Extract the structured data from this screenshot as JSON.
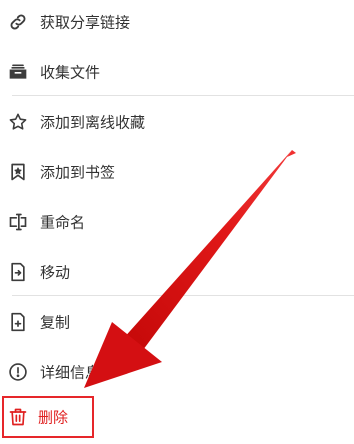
{
  "menu": {
    "items": [
      {
        "label": "获取分享链接",
        "icon": "link-icon"
      },
      {
        "label": "收集文件",
        "icon": "inbox-icon"
      },
      {
        "label": "添加到离线收藏",
        "icon": "star-icon"
      },
      {
        "label": "添加到书签",
        "icon": "bookmark-icon"
      },
      {
        "label": "重命名",
        "icon": "rename-icon"
      },
      {
        "label": "移动",
        "icon": "move-file-icon"
      },
      {
        "label": "复制",
        "icon": "copy-file-icon"
      },
      {
        "label": "详细信息",
        "icon": "info-icon"
      },
      {
        "label": "删除",
        "icon": "trash-icon"
      }
    ]
  },
  "colors": {
    "text": "#333333",
    "icon": "#3c3c3c",
    "danger": "#e02020",
    "highlight": "#e6262a",
    "divider": "#e2e2e2"
  }
}
